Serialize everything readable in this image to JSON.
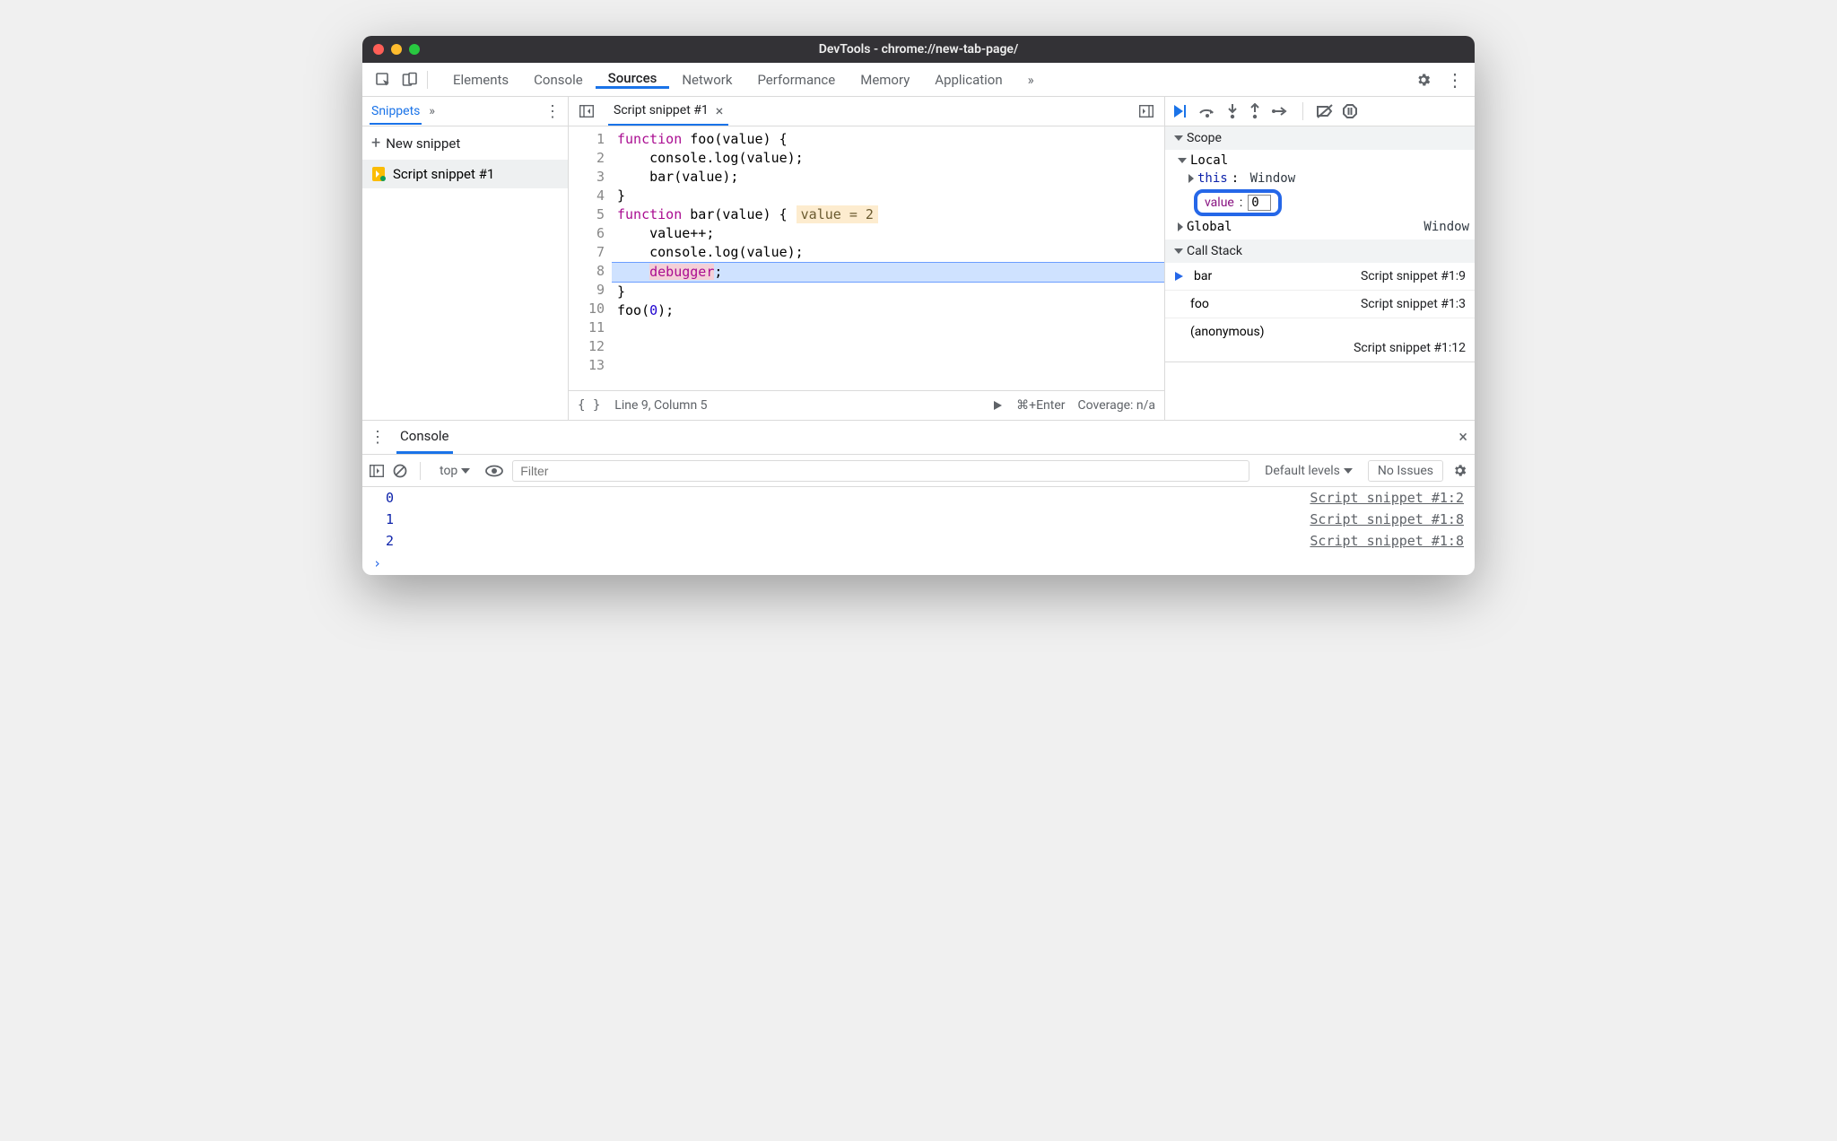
{
  "window": {
    "title": "DevTools - chrome://new-tab-page/"
  },
  "topTabs": {
    "elements": "Elements",
    "console": "Console",
    "sources": "Sources",
    "network": "Network",
    "performance": "Performance",
    "memory": "Memory",
    "application": "Application"
  },
  "leftPane": {
    "tab": "Snippets",
    "newSnippet": "New snippet",
    "items": [
      {
        "label": "Script snippet #1"
      }
    ]
  },
  "editor": {
    "fileTab": "Script snippet #1",
    "code": [
      "function foo(value) {",
      "    console.log(value);",
      "    bar(value);",
      "}",
      "",
      "function bar(value) {",
      "    value++;",
      "    console.log(value);",
      "    debugger;",
      "}",
      "",
      "foo(0);",
      ""
    ],
    "inlineHint": "value = 2",
    "statusCursor": "Line 9, Column 5",
    "runHint": "⌘+Enter",
    "coverage": "Coverage: n/a"
  },
  "scope": {
    "header": "Scope",
    "local": "Local",
    "thisLabel": "this",
    "thisVal": "Window",
    "valueLabel": "value",
    "valueEdit": "0",
    "global": "Global",
    "globalVal": "Window"
  },
  "callStack": {
    "header": "Call Stack",
    "frames": [
      {
        "name": "bar",
        "loc": "Script snippet #1:9"
      },
      {
        "name": "foo",
        "loc": "Script snippet #1:3"
      }
    ],
    "anon": "(anonymous)",
    "anonLoc": "Script snippet #1:12"
  },
  "drawer": {
    "tab": "Console",
    "context": "top",
    "filterPlaceholder": "Filter",
    "levels": "Default levels",
    "noIssues": "No Issues"
  },
  "consoleLog": [
    {
      "val": "0",
      "src": "Script snippet #1:2"
    },
    {
      "val": "1",
      "src": "Script snippet #1:8"
    },
    {
      "val": "2",
      "src": "Script snippet #1:8"
    }
  ]
}
